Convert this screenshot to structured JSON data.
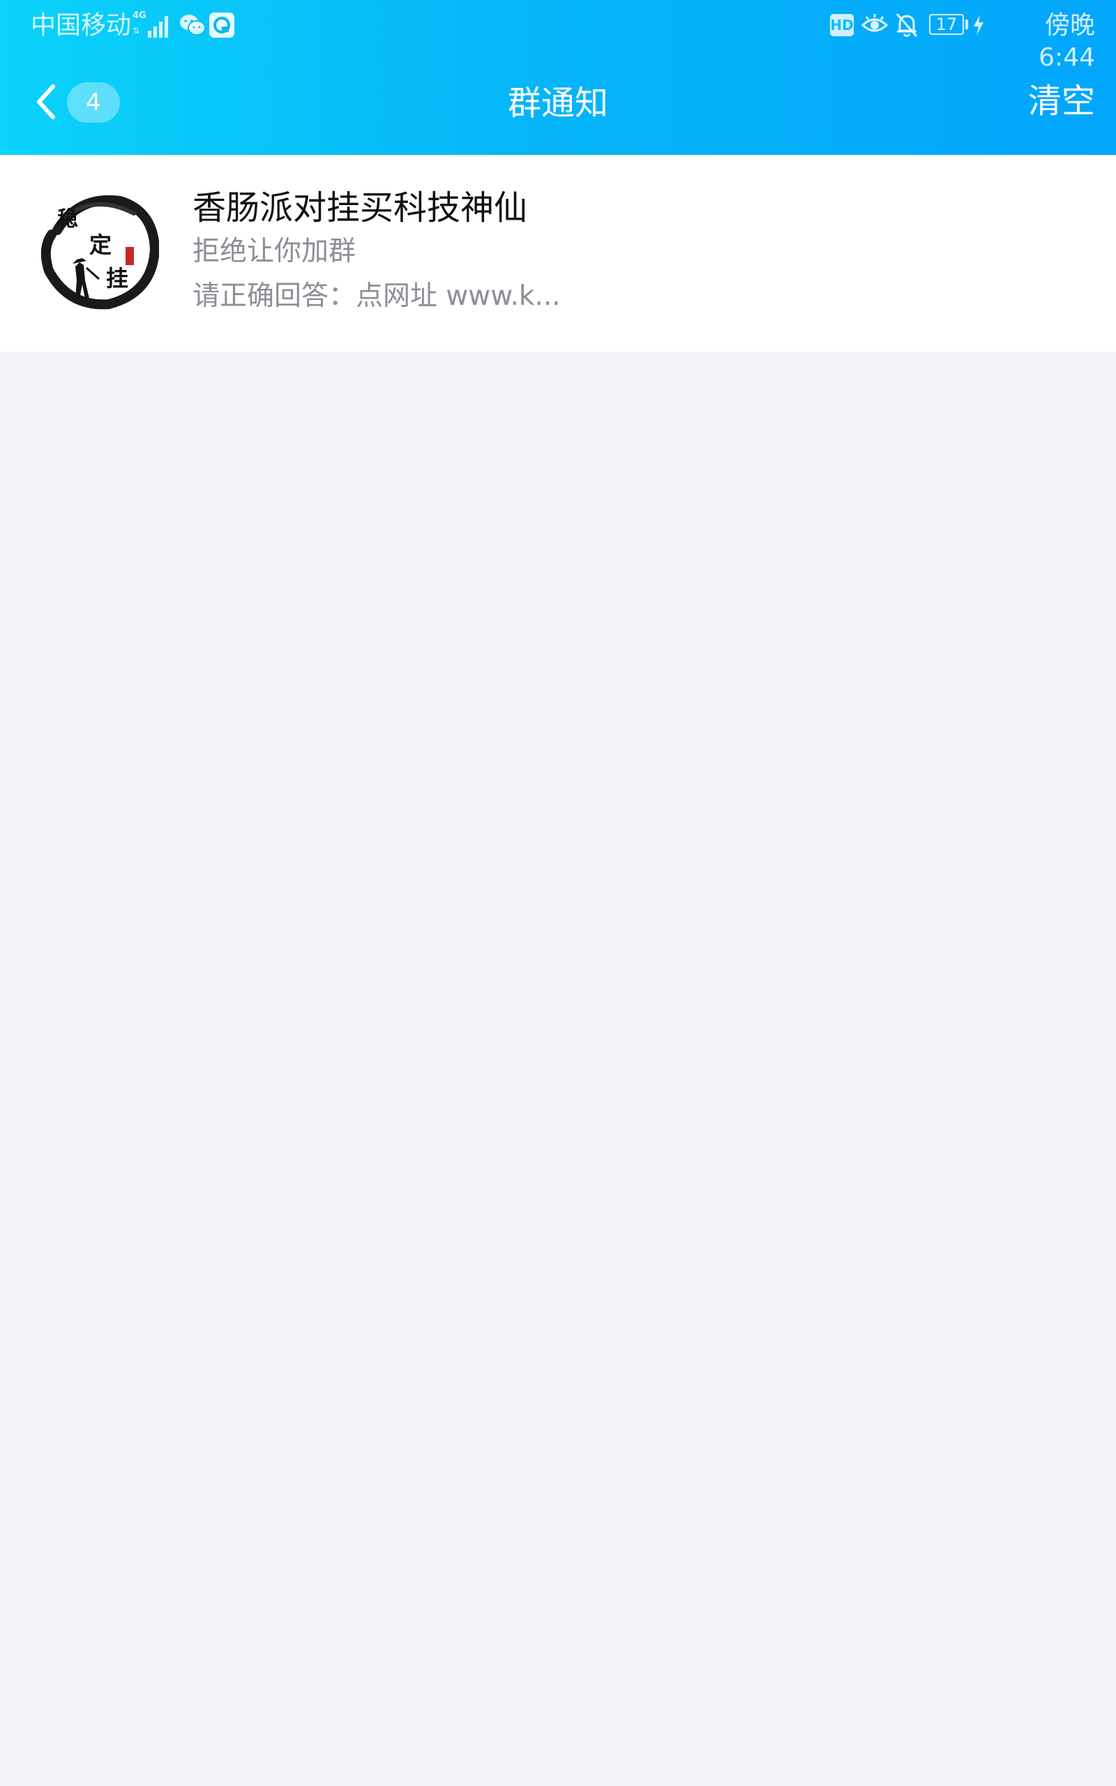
{
  "status_bar": {
    "carrier": "中国移动",
    "network_type": "4G",
    "battery_level": "17",
    "time": "傍晚6:44",
    "icons": [
      "signal-icon",
      "wechat-icon",
      "app-notification-icon",
      "hd-icon",
      "eye-icon",
      "bell-muted-icon",
      "battery-icon",
      "charging-icon"
    ]
  },
  "nav": {
    "back_badge_count": "4",
    "title": "群通知",
    "clear_label": "清空",
    "icons": [
      "back-chevron-icon"
    ]
  },
  "notifications": [
    {
      "group_name": "香肠派对挂买科技神仙",
      "status": "拒绝让你加群",
      "detail": "请正确回答：点网址 www.k...",
      "avatar_icon": "group-avatar"
    }
  ],
  "colors": {
    "header_gradient_start": "#0bd3f9",
    "header_gradient_end": "#02a6fb",
    "background": "#f3f5f9",
    "card": "#ffffff",
    "secondary_text": "#8c8f96"
  }
}
